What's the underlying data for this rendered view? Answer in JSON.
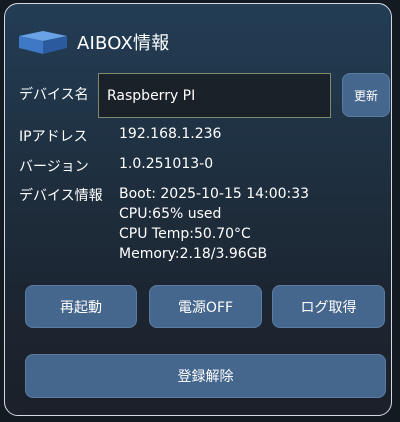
{
  "header": {
    "title": "AIBOX情報",
    "icon": "box-icon"
  },
  "device_name": {
    "label": "デバイス名",
    "value": "Raspberry PI",
    "update_button": "更新"
  },
  "ip": {
    "label": "IPアドレス",
    "value": "192.168.1.236"
  },
  "version": {
    "label": "バージョン",
    "value": "1.0.251013-0"
  },
  "device_info": {
    "label": "デバイス情報",
    "lines": [
      "Boot: 2025-10-15 14:00:33",
      "CPU:65% used",
      "CPU Temp:50.70°C",
      "Memory:2.18/3.96GB"
    ]
  },
  "actions": {
    "restart": "再起動",
    "power_off": "電源OFF",
    "get_log": "ログ取得",
    "unregister": "登録解除"
  },
  "colors": {
    "button": "#46678d",
    "panel_top": "#233d55",
    "panel_bottom": "#1b2029",
    "border": "#d4dae2"
  }
}
